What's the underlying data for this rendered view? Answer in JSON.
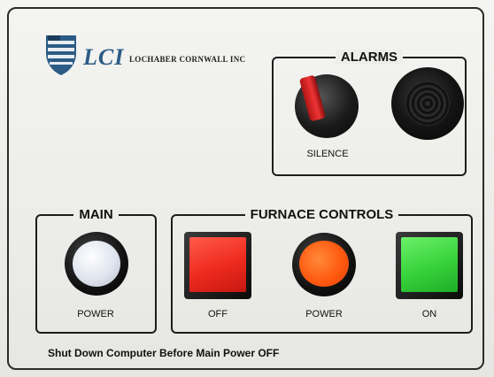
{
  "brand": {
    "logo_text": "LCI",
    "company_name": "LOCHABER CORNWALL INC",
    "logo_color": "#2c5c86"
  },
  "alarms": {
    "title": "ALARMS",
    "silence_label": "SILENCE"
  },
  "main": {
    "title": "MAIN",
    "power_label": "POWER"
  },
  "furnace_controls": {
    "title": "FURNACE CONTROLS",
    "off_label": "OFF",
    "power_label": "POWER",
    "on_label": "ON",
    "colors": {
      "off": "#ee2a1e",
      "power": "#ff5a10",
      "on": "#36d23a"
    }
  },
  "footer_note": "Shut Down Computer Before Main Power OFF",
  "icons": {
    "logo_icon": "shield-icon",
    "buzzer": "buzzer-speaker-icon",
    "keyswitch": "key-switch-icon"
  }
}
